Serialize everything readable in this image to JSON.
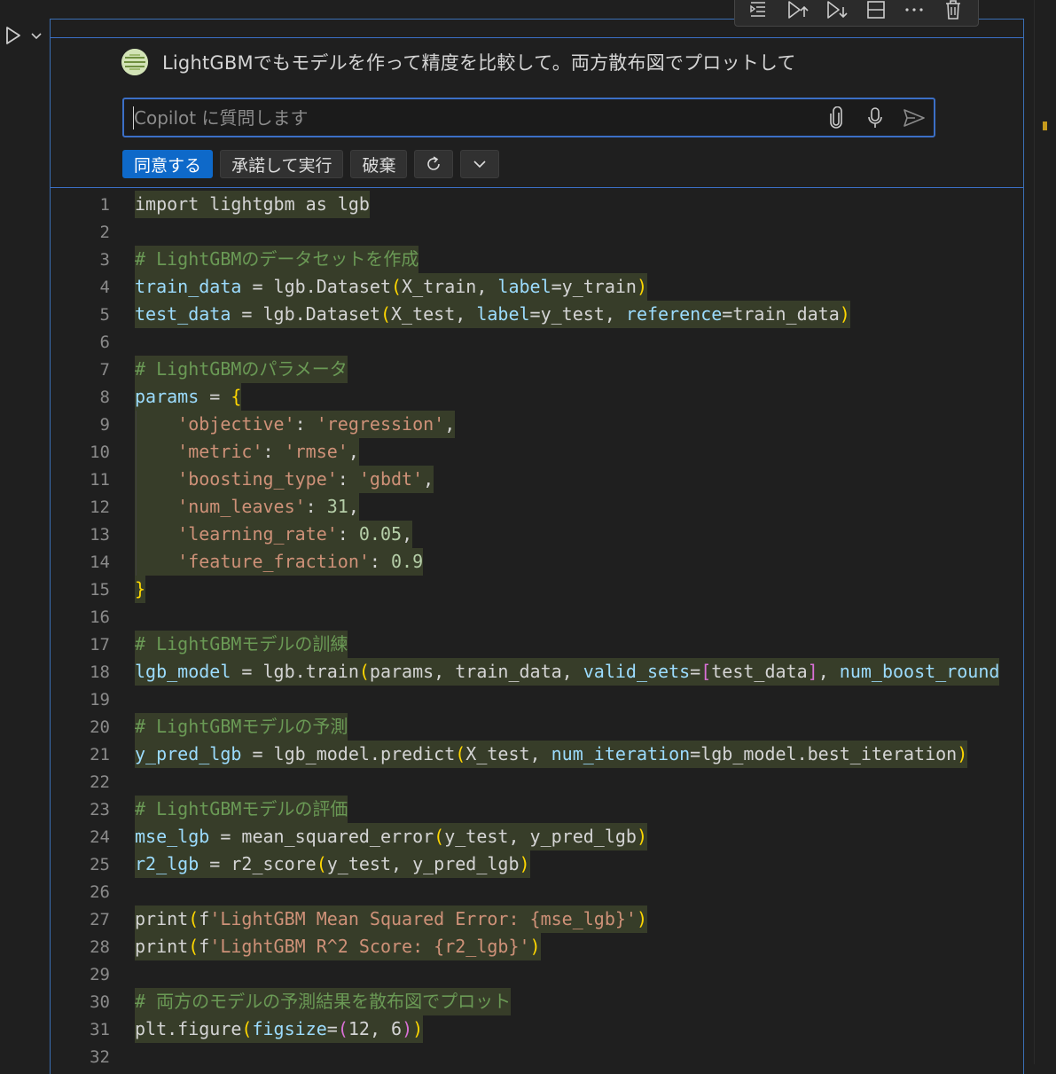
{
  "cell": {
    "toolbar": {
      "items": [
        "run-by-line-icon",
        "execute-above-icon",
        "execute-below-icon",
        "split-cell-icon",
        "more-actions-icon",
        "delete-cell-icon"
      ]
    }
  },
  "chat": {
    "prompt": "LightGBMでもモデルを作って精度を比較して。両方散布図でプロットして",
    "input_placeholder": "Copilot に質問します",
    "input_value": "",
    "buttons": {
      "accept": "同意する",
      "accept_run": "承諾して実行",
      "discard": "破棄"
    }
  },
  "code_lines": [
    [
      {
        "t": "import lightgbm as lgb",
        "c": "plain"
      }
    ],
    [],
    [
      {
        "t": "# LightGBMのデータセットを作成",
        "c": "comment"
      }
    ],
    [
      {
        "t": "train_data",
        "c": "var"
      },
      {
        "t": " = lgb.Dataset",
        "c": "plain"
      },
      {
        "t": "(",
        "c": "paren"
      },
      {
        "t": "X_train, ",
        "c": "plain"
      },
      {
        "t": "label",
        "c": "param"
      },
      {
        "t": "=y_train",
        "c": "plain"
      },
      {
        "t": ")",
        "c": "paren"
      }
    ],
    [
      {
        "t": "test_data",
        "c": "var"
      },
      {
        "t": " = lgb.Dataset",
        "c": "plain"
      },
      {
        "t": "(",
        "c": "paren"
      },
      {
        "t": "X_test, ",
        "c": "plain"
      },
      {
        "t": "label",
        "c": "param"
      },
      {
        "t": "=y_test, ",
        "c": "plain"
      },
      {
        "t": "reference",
        "c": "param"
      },
      {
        "t": "=train_data",
        "c": "plain"
      },
      {
        "t": ")",
        "c": "paren"
      }
    ],
    [],
    [
      {
        "t": "# LightGBMのパラメータ",
        "c": "comment"
      }
    ],
    [
      {
        "t": "params",
        "c": "var"
      },
      {
        "t": " = ",
        "c": "plain"
      },
      {
        "t": "{",
        "c": "brace"
      }
    ],
    [
      {
        "t": "    ",
        "c": "plain"
      },
      {
        "t": "'objective'",
        "c": "str"
      },
      {
        "t": ": ",
        "c": "plain"
      },
      {
        "t": "'regression'",
        "c": "str"
      },
      {
        "t": ",",
        "c": "plain"
      }
    ],
    [
      {
        "t": "    ",
        "c": "plain"
      },
      {
        "t": "'metric'",
        "c": "str"
      },
      {
        "t": ": ",
        "c": "plain"
      },
      {
        "t": "'rmse'",
        "c": "str"
      },
      {
        "t": ",",
        "c": "plain"
      }
    ],
    [
      {
        "t": "    ",
        "c": "plain"
      },
      {
        "t": "'boosting_type'",
        "c": "str"
      },
      {
        "t": ": ",
        "c": "plain"
      },
      {
        "t": "'gbdt'",
        "c": "str"
      },
      {
        "t": ",",
        "c": "plain"
      }
    ],
    [
      {
        "t": "    ",
        "c": "plain"
      },
      {
        "t": "'num_leaves'",
        "c": "str"
      },
      {
        "t": ": ",
        "c": "plain"
      },
      {
        "t": "31",
        "c": "num"
      },
      {
        "t": ",",
        "c": "plain"
      }
    ],
    [
      {
        "t": "    ",
        "c": "plain"
      },
      {
        "t": "'learning_rate'",
        "c": "str"
      },
      {
        "t": ": ",
        "c": "plain"
      },
      {
        "t": "0.05",
        "c": "num"
      },
      {
        "t": ",",
        "c": "plain"
      }
    ],
    [
      {
        "t": "    ",
        "c": "plain"
      },
      {
        "t": "'feature_fraction'",
        "c": "str"
      },
      {
        "t": ": ",
        "c": "plain"
      },
      {
        "t": "0.9",
        "c": "num"
      }
    ],
    [
      {
        "t": "}",
        "c": "brace"
      }
    ],
    [],
    [
      {
        "t": "# LightGBMモデルの訓練",
        "c": "comment"
      }
    ],
    [
      {
        "t": "lgb_model",
        "c": "var"
      },
      {
        "t": " = lgb.train",
        "c": "plain"
      },
      {
        "t": "(",
        "c": "paren"
      },
      {
        "t": "params, train_data, ",
        "c": "plain"
      },
      {
        "t": "valid_sets",
        "c": "param"
      },
      {
        "t": "=",
        "c": "plain"
      },
      {
        "t": "[",
        "c": "bracket"
      },
      {
        "t": "test_data",
        "c": "plain"
      },
      {
        "t": "]",
        "c": "bracket"
      },
      {
        "t": ", ",
        "c": "plain"
      },
      {
        "t": "num_boost_round",
        "c": "param"
      }
    ],
    [],
    [
      {
        "t": "# LightGBMモデルの予測",
        "c": "comment"
      }
    ],
    [
      {
        "t": "y_pred_lgb",
        "c": "var"
      },
      {
        "t": " = lgb_model.predict",
        "c": "plain"
      },
      {
        "t": "(",
        "c": "paren"
      },
      {
        "t": "X_test, ",
        "c": "plain"
      },
      {
        "t": "num_iteration",
        "c": "param"
      },
      {
        "t": "=lgb_model.best_iteration",
        "c": "plain"
      },
      {
        "t": ")",
        "c": "paren"
      }
    ],
    [],
    [
      {
        "t": "# LightGBMモデルの評価",
        "c": "comment"
      }
    ],
    [
      {
        "t": "mse_lgb",
        "c": "var"
      },
      {
        "t": " = mean_squared_error",
        "c": "plain"
      },
      {
        "t": "(",
        "c": "paren"
      },
      {
        "t": "y_test, y_pred_lgb",
        "c": "plain"
      },
      {
        "t": ")",
        "c": "paren"
      }
    ],
    [
      {
        "t": "r2_lgb",
        "c": "var"
      },
      {
        "t": " = r2_score",
        "c": "plain"
      },
      {
        "t": "(",
        "c": "paren"
      },
      {
        "t": "y_test, y_pred_lgb",
        "c": "plain"
      },
      {
        "t": ")",
        "c": "paren"
      }
    ],
    [],
    [
      {
        "t": "print",
        "c": "plain"
      },
      {
        "t": "(",
        "c": "paren"
      },
      {
        "t": "f",
        "c": "plain"
      },
      {
        "t": "'LightGBM Mean Squared Error: {mse_lgb}'",
        "c": "str"
      },
      {
        "t": ")",
        "c": "paren"
      }
    ],
    [
      {
        "t": "print",
        "c": "plain"
      },
      {
        "t": "(",
        "c": "paren"
      },
      {
        "t": "f",
        "c": "plain"
      },
      {
        "t": "'LightGBM R^2 Score: {r2_lgb}'",
        "c": "str"
      },
      {
        "t": ")",
        "c": "paren"
      }
    ],
    [],
    [
      {
        "t": "# 両方のモデルの予測結果を散布図でプロット",
        "c": "comment"
      }
    ],
    [
      {
        "t": "plt.figure",
        "c": "plain"
      },
      {
        "t": "(",
        "c": "paren"
      },
      {
        "t": "figsize",
        "c": "param"
      },
      {
        "t": "=",
        "c": "plain"
      },
      {
        "t": "(",
        "c": "bracket"
      },
      {
        "t": "12, 6",
        "c": "plain"
      },
      {
        "t": ")",
        "c": "bracket"
      },
      {
        "t": ")",
        "c": "paren"
      }
    ],
    []
  ],
  "line_numbers": [
    "1",
    "2",
    "3",
    "4",
    "5",
    "6",
    "7",
    "8",
    "9",
    "10",
    "11",
    "12",
    "13",
    "14",
    "15",
    "16",
    "17",
    "18",
    "19",
    "20",
    "21",
    "22",
    "23",
    "24",
    "25",
    "26",
    "27",
    "28",
    "29",
    "30",
    "31",
    "32"
  ],
  "colors": {
    "accent": "#0e69c9",
    "focus_border": "#3b6fc6",
    "diff_highlight": "#373d29",
    "minimap_marker": "#c59a1c"
  }
}
